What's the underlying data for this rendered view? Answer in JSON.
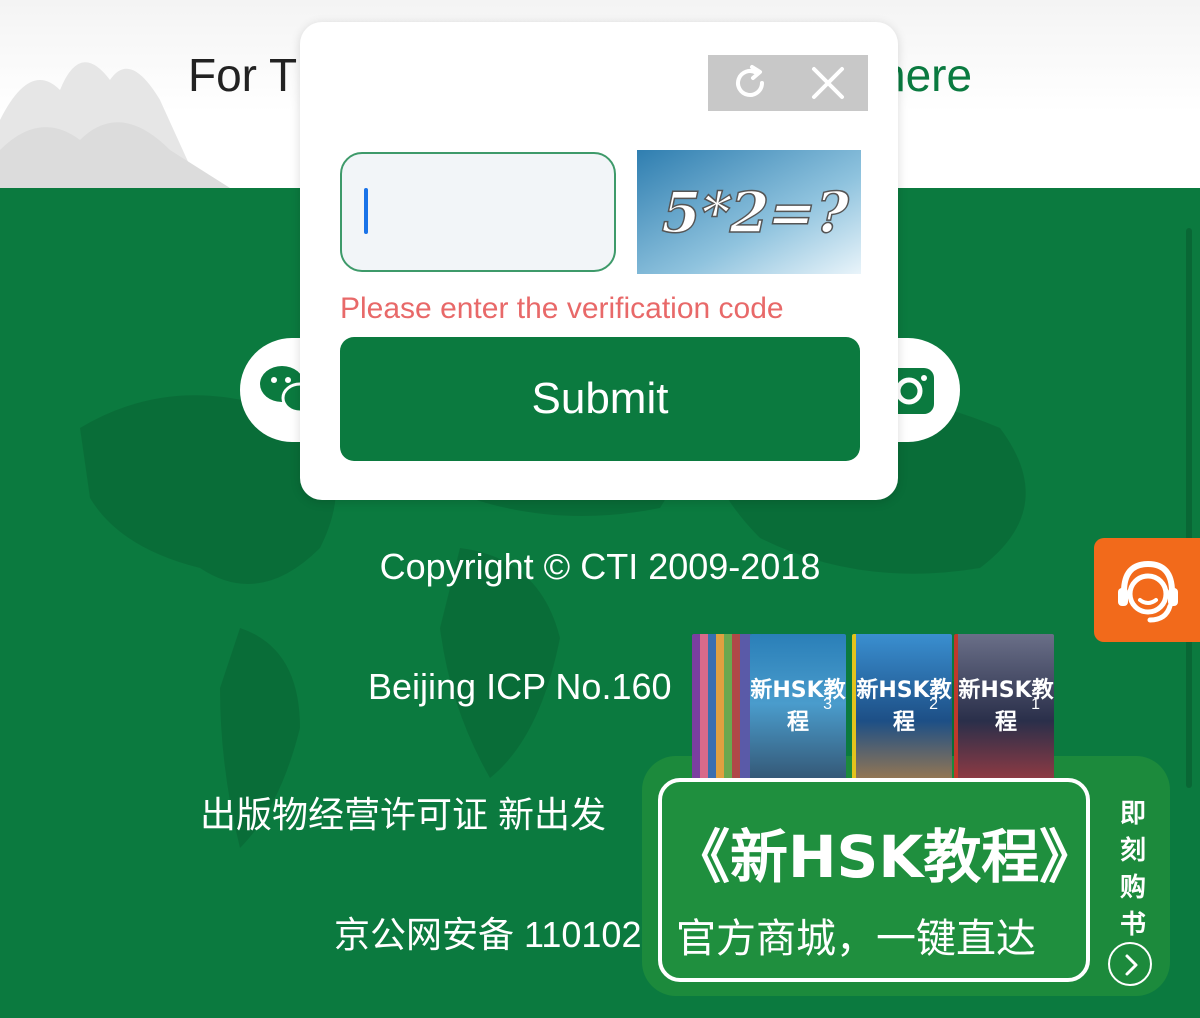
{
  "header": {
    "text_left": "For T",
    "text_right": "here"
  },
  "captcha": {
    "input_value": "",
    "image_text": "5*2=?",
    "error": "Please enter the verification code",
    "submit_label": "Submit"
  },
  "footer": {
    "copyright": "Copyright © CTI 2009-2018",
    "icp": "Beijing ICP No.160",
    "license": "出版物经营许可证 新出发",
    "beian": "京公网安备 110102"
  },
  "promo": {
    "title": "《新HSK教程》",
    "subtitle": "官方商城，一键直达",
    "side_chars": [
      "即",
      "刻",
      "购",
      "书"
    ],
    "books": [
      {
        "label": "新HSK教程",
        "number": "3"
      },
      {
        "label": "新HSK教程",
        "number": "2"
      },
      {
        "label": "新HSK教程",
        "number": "1"
      }
    ]
  },
  "colors": {
    "brand_green": "#0b7a3f",
    "error_red": "#e86969",
    "service_orange": "#f26a1b"
  }
}
